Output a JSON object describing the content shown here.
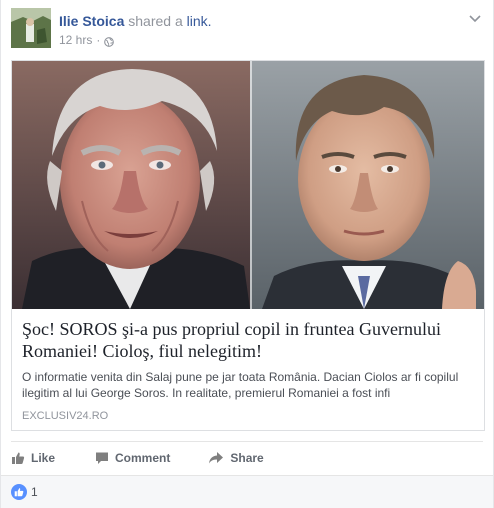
{
  "post": {
    "author": "Ilie Stoica",
    "verb": "shared a",
    "object": "link.",
    "time": "12 hrs",
    "separator": "·",
    "privacy_icon": "globe-icon",
    "menu_icon": "chevron-down-icon"
  },
  "link": {
    "title": "Şoc! SOROS şi-a pus propriul copil in fruntea Guvernului Romaniei! Cioloş, fiul nelegitim!",
    "description": "O informatie venita din Salaj pune pe jar toata România. Dacian Ciolos ar fi copilul ilegitim al lui George Soros. In realitate, premierul Romaniei a fost infi",
    "source": "EXCLUSIV24.RO"
  },
  "actions": {
    "like_label": "Like",
    "comment_label": "Comment",
    "share_label": "Share"
  },
  "reactions": {
    "icon": "like-badge-icon",
    "count": "1"
  },
  "colors": {
    "link_blue": "#365899",
    "like_blue": "#5890ff",
    "muted": "#90949c"
  }
}
